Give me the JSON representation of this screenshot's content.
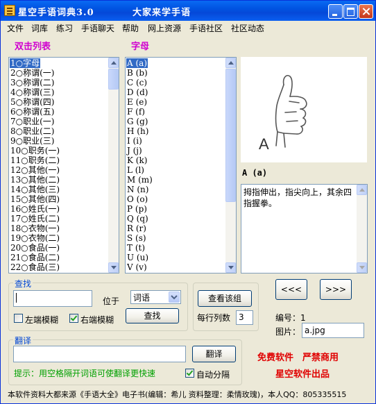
{
  "window": {
    "title": "星空手语词典3.0",
    "subtitle": "大家来学手语"
  },
  "menu": [
    "文件",
    "词库",
    "练习",
    "手语聊天",
    "帮助",
    "网上资源",
    "手语社区",
    "社区动态"
  ],
  "left_list": {
    "header": "双击列表",
    "items": [
      "1○字母",
      "2○称谓(一)",
      "3○称谓(二)",
      "4○称谓(三)",
      "5○称谓(四)",
      "6○称谓(五)",
      "7○职业(一)",
      "8○职业(二)",
      "9○职业(三)",
      "10○职务(一)",
      "11○职务(二)",
      "12○其他(一)",
      "13○其他(二)",
      "14○其他(三)",
      "15○其他(四)",
      "16○姓氏(一)",
      "17○姓氏(二)",
      "18○衣物(一)",
      "19○衣物(二)",
      "20○食品(一)",
      "21○食品(二)",
      "22○食品(三)"
    ],
    "selected_index": 0
  },
  "right_list": {
    "header": "字母",
    "items": [
      "A (a)",
      "B (b)",
      "C (c)",
      "D (d)",
      "E (e)",
      "F (f)",
      "G (g)",
      "H (h)",
      "I (i)",
      "J (j)",
      "K (k)",
      "L (l)",
      "M (m)",
      "N (n)",
      "O (o)",
      "P (p)",
      "Q (q)",
      "R (r)",
      "S (s)",
      "T (t)",
      "U (u)",
      "V (v)"
    ],
    "selected_index": 0
  },
  "preview": {
    "image_letter": "A",
    "caption": "A (a)",
    "description": "拇指伸出，指尖向上，其余四指握拳。"
  },
  "search": {
    "group_label": "查找",
    "input_value": "",
    "position_label": "位于",
    "select_value": "词语",
    "left_fuzzy_label": "左端模糊",
    "left_fuzzy_checked": false,
    "right_fuzzy_label": "右端模糊",
    "right_fuzzy_checked": true,
    "find_button": "查找"
  },
  "view_group": {
    "view_button": "查看该组",
    "columns_label": "每行列数",
    "columns_value": "3"
  },
  "nav": {
    "prev_button": "<<<",
    "next_button": ">>>"
  },
  "info": {
    "number_label": "编号：1",
    "image_label": "图片：",
    "image_value": "a.jpg"
  },
  "translate": {
    "group_label": "翻译",
    "input_value": "",
    "button": "翻译",
    "hint": "提示：用空格隔开词语可使翻译更快速",
    "auto_split_label": "自动分隔",
    "auto_split_checked": true
  },
  "promo": {
    "line1": "免费软件　严禁商用",
    "line2": "星空软件出品"
  },
  "footer": "本软件资料大都来源《手语大全》电子书(编辑：希儿 资料整理：柔情玫瑰)，本人QQ：805335515",
  "colors": {
    "header_magenta": "#d000d0",
    "hint_green": "#00a000",
    "promo_red": "#e00000",
    "selection_blue": "#316ac5"
  }
}
